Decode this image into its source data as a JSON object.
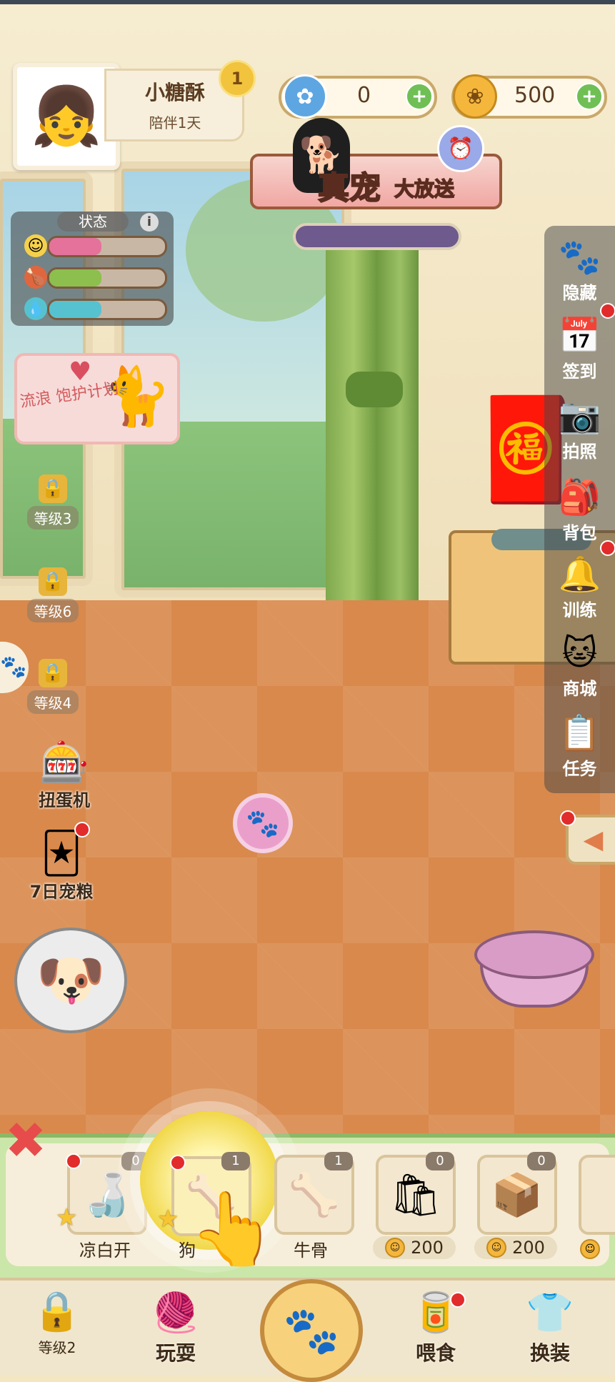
{
  "player": {
    "name": "小糖酥",
    "companion_days": "陪伴1天",
    "level": "1"
  },
  "currency": {
    "gems": {
      "icon": "paw-gem-icon",
      "value": "0"
    },
    "coins": {
      "icon": "paw-coin-icon",
      "value": "500"
    }
  },
  "banner": {
    "text_main": "真宠",
    "text_sub": "大放送"
  },
  "status": {
    "title": "状态",
    "info": "i",
    "bars": [
      {
        "icon": "mood-face-icon",
        "fill": 0.45,
        "color": "#e4729b"
      },
      {
        "icon": "drumstick-icon",
        "fill": 0.45,
        "color": "#8cbf4e"
      },
      {
        "icon": "water-drop-icon",
        "fill": 0.45,
        "color": "#57c2cf"
      }
    ]
  },
  "stray_plan": {
    "text": "流浪 饱护计划"
  },
  "left_buttons": {
    "locked": [
      {
        "label": "等级3"
      },
      {
        "label": "等级6"
      },
      {
        "label": "等级4"
      }
    ],
    "gacha": "扭蛋机",
    "food7": "7日宠粮"
  },
  "right_menu": [
    {
      "label": "隐藏",
      "icon": "paw-frame-icon"
    },
    {
      "label": "签到",
      "icon": "calendar-check-icon"
    },
    {
      "label": "拍照",
      "icon": "camera-icon"
    },
    {
      "label": "背包",
      "icon": "backpack-icon"
    },
    {
      "label": "训练",
      "icon": "bell-collar-icon"
    },
    {
      "label": "商城",
      "icon": "shop-cat-icon"
    },
    {
      "label": "任务",
      "icon": "clipboard-icon"
    }
  ],
  "food_items": [
    {
      "name": "凉白开",
      "count": "0",
      "icon": "water-bottle-icon"
    },
    {
      "name": "狗",
      "count": "1",
      "icon": "dog-food-icon"
    },
    {
      "name": "牛骨",
      "count": "1",
      "icon": "bone-icon"
    },
    {
      "count": "0",
      "price": "200",
      "icon": "food-bag-icon"
    },
    {
      "count": "0",
      "price": "200",
      "icon": "food-box-icon"
    }
  ],
  "bottom_nav": {
    "locked_label": "等级2",
    "play": "玩耍",
    "feed": "喂食",
    "dress": "换装"
  }
}
